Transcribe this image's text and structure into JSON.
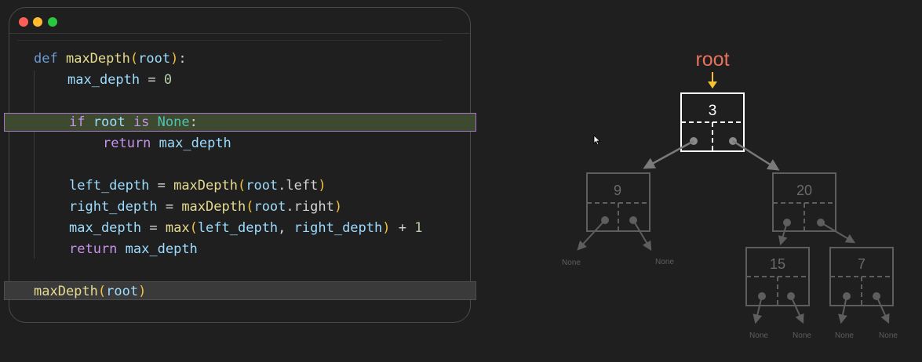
{
  "window": {
    "buttons": [
      "close",
      "minimize",
      "maximize"
    ],
    "colors": {
      "close": "#ff5f57",
      "minimize": "#febc2e",
      "maximize": "#28c840"
    }
  },
  "code": {
    "l1": {
      "def": "def",
      "fn": "maxDepth",
      "p1": "(",
      "arg": "root",
      "p2": ")",
      "colon": ":"
    },
    "l2": {
      "var": "max_depth",
      "eq": " = ",
      "num": "0"
    },
    "l3": {
      "kw_if": "if",
      "var": "root",
      "kw_is": "is",
      "none": "None",
      "colon": ":"
    },
    "l4": {
      "kw": "return",
      "var": "max_depth"
    },
    "l5": {
      "var": "left_depth",
      "eq": " = ",
      "fn": "maxDepth",
      "p1": "(",
      "arg": "root",
      "dot": ".",
      "attr": "left",
      "p2": ")"
    },
    "l6": {
      "var": "right_depth",
      "eq": " = ",
      "fn": "maxDepth",
      "p1": "(",
      "arg": "root",
      "dot": ".",
      "attr": "right",
      "p2": ")"
    },
    "l7": {
      "var": "max_depth",
      "eq": " = ",
      "fn": "max",
      "p1": "(",
      "a1": "left_depth",
      "comma": ", ",
      "a2": "right_depth",
      "p2": ")",
      "plus": " + ",
      "num": "1"
    },
    "l8": {
      "kw": "return",
      "var": "max_depth"
    },
    "l9": {
      "fn": "maxDepth",
      "p1": "(",
      "arg": "root",
      "p2": ")"
    }
  },
  "tree": {
    "root_label": "root",
    "nodes": {
      "n3": "3",
      "n9": "9",
      "n20": "20",
      "n15": "15",
      "n7": "7"
    },
    "none_label": "None",
    "colors": {
      "root_label": "#e8735a",
      "arrow": "#f2c230",
      "active": "#ffffff",
      "inactive": "#5e5e5e"
    }
  }
}
